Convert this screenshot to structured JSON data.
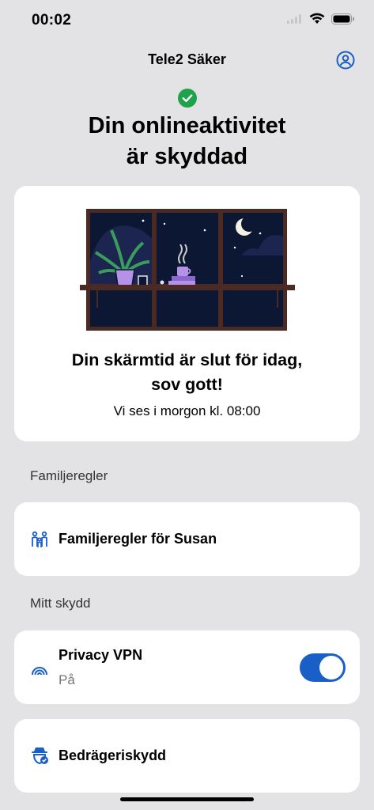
{
  "status_bar": {
    "time": "00:02"
  },
  "nav": {
    "title": "Tele2 Säker"
  },
  "headline": {
    "line1": "Din onlineaktivitet",
    "line2": "är skyddad"
  },
  "screen_time_card": {
    "title_line1": "Din skärmtid är slut för idag,",
    "title_line2": "sov gott!",
    "subtitle": "Vi ses i morgon kl. 08:00"
  },
  "family_section": {
    "label": "Familjeregler",
    "item_label": "Familjeregler för Susan",
    "item_icon": "family-icon"
  },
  "protection_section": {
    "label": "Mitt skydd",
    "vpn": {
      "label": "Privacy VPN",
      "status": "På",
      "enabled": true,
      "icon": "vpn-signal-icon"
    },
    "fraud": {
      "label": "Bedrägeriskydd",
      "icon": "fraud-shield-icon"
    }
  },
  "colors": {
    "accent": "#1a5fc7",
    "check_green": "#1ea34a",
    "background": "#e3e3e6"
  }
}
